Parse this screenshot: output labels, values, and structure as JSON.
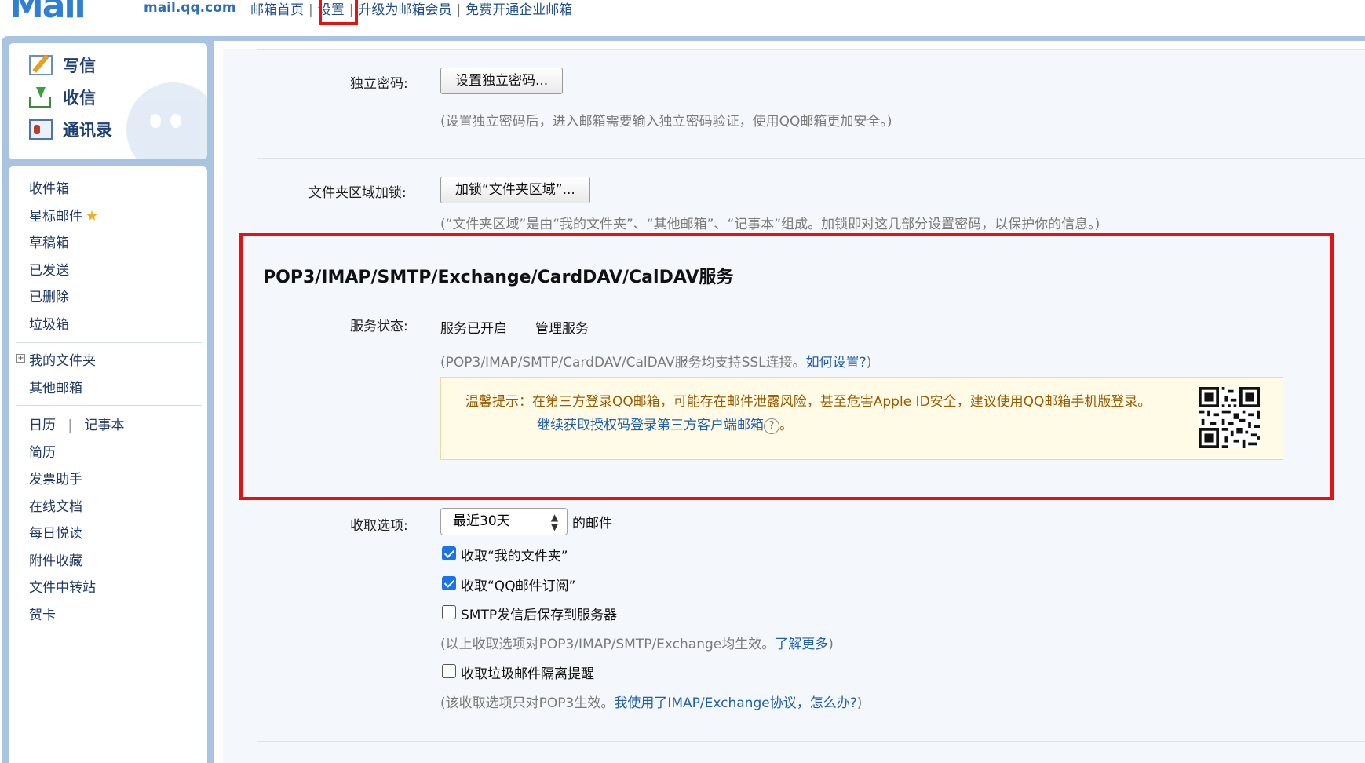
{
  "app": {
    "logo": "Mail",
    "url": "mail.qq.com",
    "nav": [
      "邮箱首页",
      "设置",
      "升级为邮箱会员",
      "免费开通企业邮箱"
    ]
  },
  "sidebar": {
    "quick": [
      {
        "label": "写信",
        "icon": "write-icon"
      },
      {
        "label": "收信",
        "icon": "inbox-download-icon"
      },
      {
        "label": "通讯录",
        "icon": "contacts-icon"
      }
    ],
    "folders": [
      "收件箱",
      "星标邮件",
      "草稿箱",
      "已发送",
      "已删除",
      "垃圾箱"
    ],
    "my_folders": "我的文件夹",
    "other_mail": "其他邮箱",
    "calendar": "日历",
    "notes": "记事本",
    "apps": [
      "简历",
      "发票助手",
      "在线文档",
      "每日悦读",
      "附件收藏",
      "文件中转站",
      "贺卡"
    ]
  },
  "settings": {
    "password_label": "独立密码:",
    "password_btn": "设置独立密码...",
    "password_hint": "(设置独立密码后，进入邮箱需要输入独立密码验证，使用QQ邮箱更加安全。)",
    "folderlock_label": "文件夹区域加锁:",
    "folderlock_btn": "加锁“文件夹区域”...",
    "folderlock_hint": "(“文件夹区域”是由“我的文件夹”、“其他邮箱”、“记事本”组成。加锁即对这几部分设置密码，以保护你的信息。)",
    "section_title": "POP3/IMAP/SMTP/Exchange/CardDAV/CalDAV服务",
    "status_label": "服务状态:",
    "status_value": "服务已开启",
    "manage_link": "管理服务",
    "ssl_hint_prefix": "(POP3/IMAP/SMTP/CardDAV/CalDAV服务均支持SSL连接。",
    "ssl_hint_link": "如何设置?",
    "ssl_hint_suffix": ")",
    "warn_text": "温馨提示：在第三方登录QQ邮箱，可能存在邮件泄露风险，甚至危害Apple ID安全，建议使用QQ邮箱手机版登录。",
    "warn_link": "继续获取授权码登录第三方客户端邮箱",
    "warn_help": "?",
    "warn_suffix": "。",
    "receive_label": "收取选项:",
    "receive_select": "最近30天",
    "receive_suffix": "的邮件",
    "options": [
      {
        "label": "收取“我的文件夹”",
        "checked": true
      },
      {
        "label": "收取“QQ邮件订阅”",
        "checked": true
      },
      {
        "label": "SMTP发信后保存到服务器",
        "checked": false
      }
    ],
    "options_hint_prefix": "(以上收取选项对POP3/IMAP/SMTP/Exchange均生效。",
    "options_hint_link": "了解更多",
    "options_hint_suffix": ")",
    "spam_option": {
      "label": "收取垃圾邮件隔离提醒",
      "checked": false
    },
    "spam_hint_prefix": "(该收取选项只对POP3生效。",
    "spam_hint_link": "我使用了IMAP/Exchange协议，怎么办?",
    "spam_hint_suffix": ")"
  },
  "colors": {
    "highlight": "#e31313",
    "link": "#1f5fb0",
    "frame": "#a9c4e3"
  }
}
